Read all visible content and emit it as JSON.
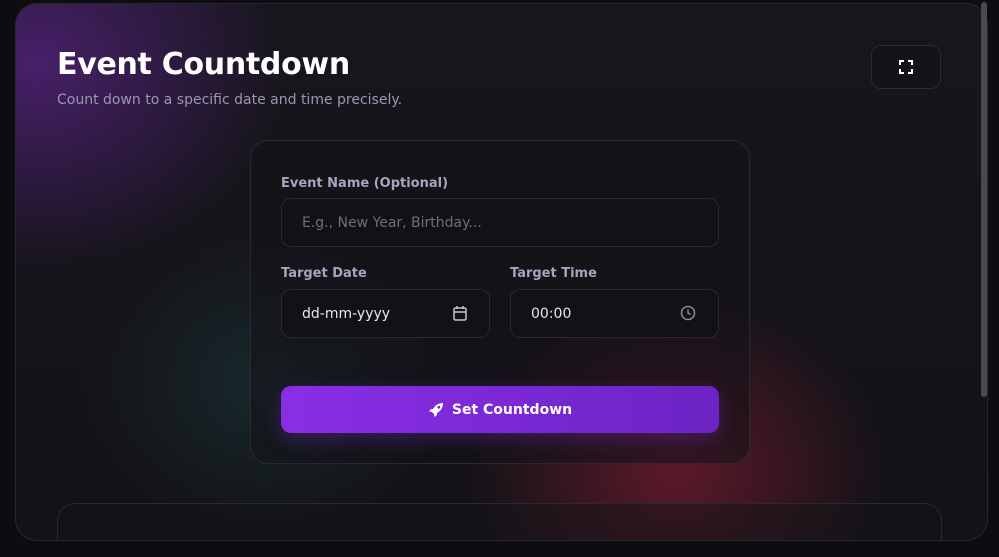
{
  "header": {
    "title": "Event Countdown",
    "subtitle": "Count down to a specific date and time precisely.",
    "fullscreen_icon": "fullscreen-icon"
  },
  "form": {
    "event_name_label": "Event Name (Optional)",
    "event_name_placeholder": "E.g., New Year, Birthday...",
    "event_name_value": "",
    "target_date_label": "Target Date",
    "target_date_value": "dd-mm-yyyy",
    "target_time_label": "Target Time",
    "target_time_value": "00:00",
    "submit_label": "Set Countdown",
    "submit_icon": "rocket-icon",
    "calendar_icon": "calendar-icon",
    "clock_icon": "clock-icon"
  },
  "colors": {
    "accent": "#8a2ee6",
    "background": "#131217"
  }
}
